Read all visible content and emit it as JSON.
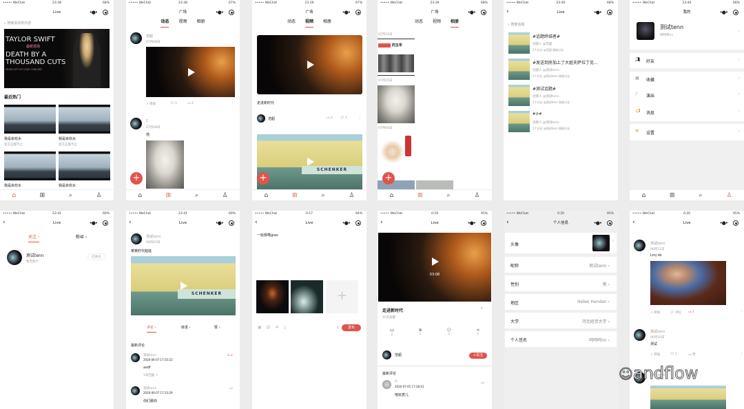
{
  "colors": {
    "accent": "#e0544c",
    "background": "#ececec"
  },
  "tabbar": {
    "home": "home-icon",
    "square": "grid-icon",
    "search": "search-icon",
    "me": "user-icon"
  },
  "s1": {
    "carrier": "••••• WeChat",
    "time": "23:38",
    "battery": "68%",
    "title": "Live",
    "search_placeholder": "搜索喜欢的内容",
    "banner": {
      "line1": "TAYLOR SWIFT",
      "line2": "最新现场",
      "line3": "DEATH BY A",
      "line4": "THOUSAND CUTS",
      "line5": "FROM CITY OF LOVE CONCERT"
    },
    "section": "最近热门",
    "items": [
      {
        "title": "我是余欢水",
        "sub": "官方正版不止"
      },
      {
        "title": "我是余欢水",
        "sub": "官方正版不止"
      },
      {
        "title": "我是余欢水"
      },
      {
        "title": "我是余欢水"
      }
    ]
  },
  "s2": {
    "carrier": "••••• WeChat",
    "time": "23:38",
    "battery": "67%",
    "title": "广场",
    "tabs": [
      "动态",
      "视频",
      "相册"
    ],
    "posts": [
      {
        "user": "范超",
        "date": "07月08日",
        "repost": "转发",
        "comments": "1",
        "likes": "2"
      },
      {
        "user": "C",
        "date": "07月08日",
        "text": "他"
      }
    ]
  },
  "s3": {
    "carrier": "••••• WeChat",
    "time": "23:39",
    "battery": "67%",
    "title": "广场",
    "tabs": [
      "动态",
      "视频",
      "相册"
    ],
    "video": {
      "title": "走进新时代",
      "user": "范超",
      "likes": "2",
      "comments": "1"
    },
    "video2": {
      "sign": "SCHENKER"
    }
  },
  "s4": {
    "carrier": "••••• WeChat",
    "time": "23:39",
    "battery": "68%",
    "title": "广场",
    "tabs": [
      "动态",
      "视频",
      "相册"
    ],
    "dates": [
      "07月31日",
      "07月25日",
      "07月04日"
    ],
    "headline": "的五年"
  },
  "s5": {
    "carrier": "••••• WeChat",
    "time": "23:40",
    "battery": "68%",
    "title": "Live",
    "search_placeholder": "搜索话题",
    "topics": [
      {
        "title": "#话题终结者#",
        "creator": "创建人 @范超",
        "meta": "1个讨论 @范超 刚刚讨论"
      },
      {
        "title": "#发送到房加上了大姐夫萨拉丁见...",
        "creator": "创建人 @测试tenn",
        "meta": "1个讨论 @测试tenn 刚刚讨论"
      },
      {
        "title": "#测试话题#",
        "creator": "创建人 @测试tenn",
        "meta": "1个讨论 @测试tenn 刚刚讨论"
      },
      {
        "title": "#计#",
        "creator": "创建人 @测试tenn",
        "meta": "1个讨论 @测试tenn 刚刚讨论"
      }
    ]
  },
  "s6": {
    "carrier": "••••• WeChat",
    "time": "23:40",
    "battery": "68%",
    "title": "我的",
    "name": "测试tenn",
    "signature": "呵呵呵nn",
    "menu": [
      "好友",
      "收藏",
      "演出",
      "消息",
      "设置"
    ]
  },
  "s7": {
    "carrier": "••••• WeChat",
    "time": "23:41",
    "battery": "69%",
    "title": "Live",
    "tabs": [
      "关注",
      "粉丝"
    ],
    "user": {
      "name": "测试tenn",
      "bio": "暂无简介",
      "button": "已关注"
    }
  },
  "s8": {
    "carrier": "••••• WeChat",
    "time": "23:41",
    "battery": "69%",
    "title": "Live",
    "user": "测试tenn",
    "date": "06月07日",
    "text": "菜奥时代蛙蛙",
    "sign": "SCHENKER",
    "tabs": [
      "评论",
      "转发",
      "赞"
    ],
    "section": "最新评论",
    "comments": [
      {
        "user": "测试tenn",
        "time": "2020-06-07 17:35:22",
        "text": "asdf",
        "replies": "1条回复 >",
        "likes": "1"
      },
      {
        "user": "测试tenn",
        "time": "2020-06-07 17:33:29",
        "text": "你们那你"
      }
    ]
  },
  "s9": {
    "carrier": "••••• WeChat",
    "time": "0:17",
    "battery": "94%",
    "title": "Live",
    "text": "一给我嘞giao",
    "count": "0",
    "publish": "发布"
  },
  "s10": {
    "carrier": "••••• WeChat",
    "time": "0:19",
    "battery": "95%",
    "title": "Live",
    "duration": "03:08",
    "video_title": "走进新时代",
    "views": "10次观看",
    "stats": [
      "2",
      "1",
      "1",
      "1"
    ],
    "user": "范超",
    "follow": "+关注",
    "section": "最新评论",
    "comment": {
      "user": "fc",
      "time": "2020-07-05 17:28:41",
      "text": "啥玩意儿"
    }
  },
  "s11": {
    "carrier": "••••• WeChat",
    "time": "0:20",
    "battery": "95%",
    "title": "个人信息",
    "rows": [
      {
        "k": "头像"
      },
      {
        "k": "昵称",
        "v": "测试tenn"
      },
      {
        "k": "性别",
        "v": "男"
      },
      {
        "k": "地区",
        "v": "Hebei Handan"
      },
      {
        "k": "大学",
        "v": "河北经贸大学"
      },
      {
        "k": "个人签名",
        "v": "呵呵呵nn"
      }
    ]
  },
  "s12": {
    "carrier": "••••• WeChat",
    "time": "0:20",
    "battery": "95%",
    "title": "Live",
    "posts": [
      {
        "user": "测试tenn",
        "date": "06月11日",
        "text": "Lmj sb",
        "repost": "转发",
        "comment": "评论",
        "likes": "1"
      },
      {
        "user": "测试tenn",
        "date": "06月10日",
        "text": "测试",
        "repost": "转发",
        "comments": "1",
        "like": "赞"
      },
      {
        "user": "测试tenn"
      }
    ],
    "watermark": "andflow"
  }
}
